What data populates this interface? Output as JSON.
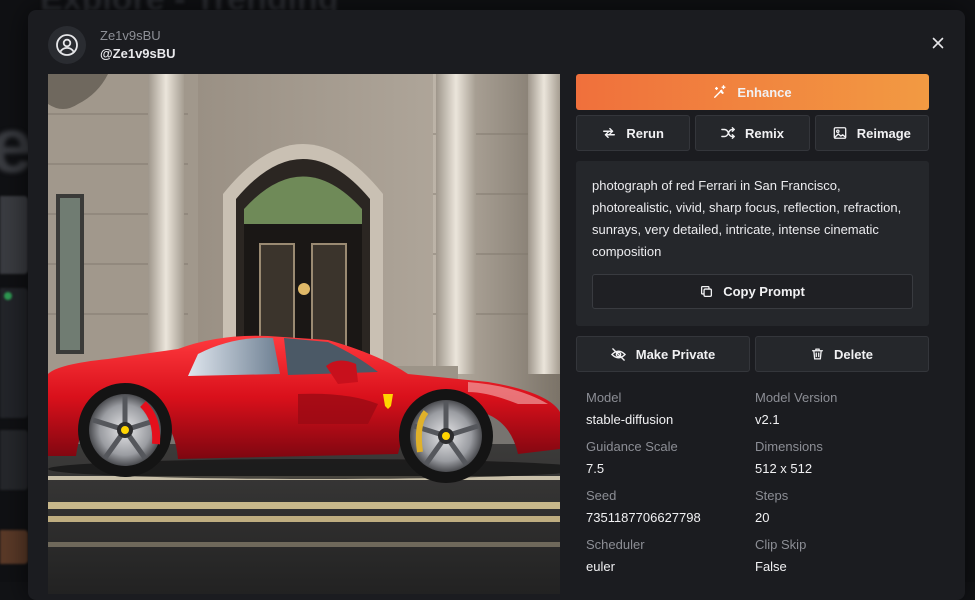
{
  "backdrop": {
    "title_text": "Explore - Trending",
    "big_letter": "ea"
  },
  "user": {
    "display_name": "Ze1v9sBU",
    "handle": "@Ze1v9sBU"
  },
  "actions": {
    "enhance_label": "Enhance",
    "rerun_label": "Rerun",
    "remix_label": "Remix",
    "reimage_label": "Reimage",
    "copy_prompt_label": "Copy Prompt",
    "make_private_label": "Make Private",
    "delete_label": "Delete"
  },
  "prompt": {
    "text": "photograph of red Ferrari in San Francisco, photorealistic, vivid, sharp focus, reflection, refraction, sunrays, very detailed, intricate, intense cinematic composition"
  },
  "details": {
    "model_label": "Model",
    "model_value": "stable-diffusion",
    "model_version_label": "Model Version",
    "model_version_value": "v2.1",
    "guidance_label": "Guidance Scale",
    "guidance_value": "7.5",
    "dimensions_label": "Dimensions",
    "dimensions_value": "512 x 512",
    "seed_label": "Seed",
    "seed_value": "7351187706627798",
    "steps_label": "Steps",
    "steps_value": "20",
    "scheduler_label": "Scheduler",
    "scheduler_value": "euler",
    "clip_skip_label": "Clip Skip",
    "clip_skip_value": "False"
  },
  "icons": {
    "avatar": "user-circle-icon",
    "close": "close-icon",
    "enhance": "magic-wand-icon",
    "rerun": "repeat-icon",
    "remix": "shuffle-icon",
    "reimage": "image-icon",
    "copy": "copy-icon",
    "private": "eye-off-icon",
    "delete": "trash-icon"
  },
  "colors": {
    "enhance_start": "#f0703c",
    "enhance_end": "#f29a42",
    "modal_bg": "#1b1c20",
    "panel_bg": "#25272b"
  }
}
